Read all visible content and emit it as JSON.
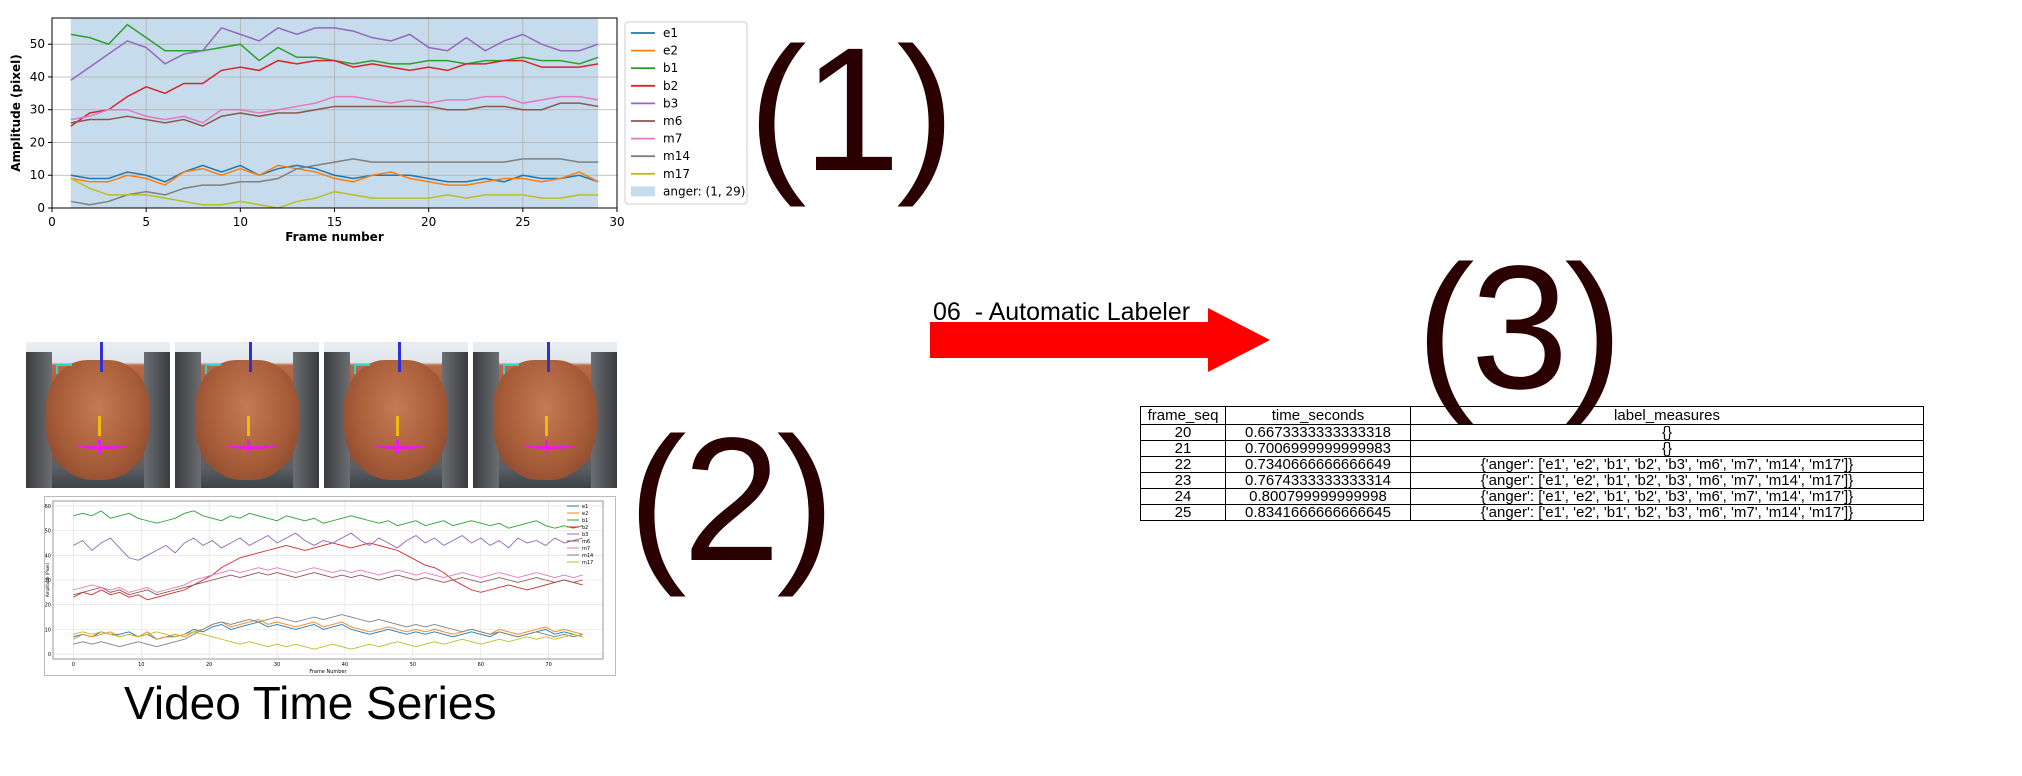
{
  "panel_labels": {
    "p1": "(1)",
    "p2": "(2)",
    "p3": "(3)"
  },
  "caption": "Video Time Series",
  "arrow_label": "06  - Automatic Labeler",
  "colors": {
    "arrow": "#ff0000",
    "panel_label": "#2b0000",
    "band": "#c6dcec"
  },
  "chart_data": [
    {
      "type": "line",
      "title": "",
      "xlabel": "Frame number",
      "ylabel": "Amplitude (pixel)",
      "xlim": [
        0,
        30
      ],
      "ylim": [
        0,
        58
      ],
      "xticks": [
        0,
        5,
        10,
        15,
        20,
        25,
        30
      ],
      "yticks": [
        0,
        10,
        20,
        30,
        40,
        50
      ],
      "grid": true,
      "legend_position": "outside-right",
      "band": {
        "label": "anger: (1, 29)",
        "x0": 1,
        "x1": 29
      },
      "x": [
        1,
        2,
        3,
        4,
        5,
        6,
        7,
        8,
        9,
        10,
        11,
        12,
        13,
        14,
        15,
        16,
        17,
        18,
        19,
        20,
        21,
        22,
        23,
        24,
        25,
        26,
        27,
        28,
        29
      ],
      "series": [
        {
          "name": "e1",
          "color": "#1f77b4",
          "values": [
            10,
            9,
            9,
            11,
            10,
            8,
            11,
            13,
            11,
            13,
            10,
            12,
            13,
            12,
            10,
            9,
            10,
            10,
            10,
            9,
            8,
            8,
            9,
            8,
            10,
            9,
            9,
            10,
            8
          ]
        },
        {
          "name": "e2",
          "color": "#ff7f0e",
          "values": [
            9,
            8,
            8,
            10,
            9,
            7,
            11,
            12,
            10,
            12,
            10,
            13,
            12,
            11,
            9,
            8,
            10,
            11,
            9,
            8,
            7,
            7,
            8,
            9,
            9,
            8,
            9,
            11,
            8
          ]
        },
        {
          "name": "b1",
          "color": "#2ca02c",
          "values": [
            53,
            52,
            50,
            56,
            52,
            48,
            48,
            48,
            49,
            50,
            45,
            49,
            46,
            46,
            45,
            44,
            45,
            44,
            44,
            45,
            45,
            44,
            45,
            45,
            46,
            45,
            45,
            44,
            46
          ]
        },
        {
          "name": "b2",
          "color": "#d62728",
          "values": [
            25,
            29,
            30,
            34,
            37,
            35,
            38,
            38,
            42,
            43,
            42,
            45,
            44,
            45,
            45,
            43,
            44,
            43,
            42,
            43,
            42,
            44,
            44,
            45,
            45,
            43,
            43,
            43,
            44
          ]
        },
        {
          "name": "b3",
          "color": "#9467bd",
          "values": [
            39,
            43,
            47,
            51,
            49,
            44,
            47,
            48,
            55,
            53,
            51,
            55,
            53,
            55,
            55,
            54,
            52,
            51,
            53,
            49,
            48,
            52,
            48,
            51,
            53,
            50,
            48,
            48,
            50
          ]
        },
        {
          "name": "m6",
          "color": "#8c564b",
          "values": [
            26,
            27,
            27,
            28,
            27,
            26,
            27,
            25,
            28,
            29,
            28,
            29,
            29,
            30,
            31,
            31,
            31,
            31,
            31,
            31,
            30,
            30,
            31,
            31,
            30,
            30,
            32,
            32,
            31
          ]
        },
        {
          "name": "m7",
          "color": "#e377c2",
          "values": [
            27,
            28,
            30,
            30,
            28,
            27,
            28,
            26,
            30,
            30,
            29,
            30,
            31,
            32,
            34,
            34,
            33,
            32,
            33,
            32,
            33,
            33,
            34,
            34,
            32,
            33,
            34,
            34,
            33
          ]
        },
        {
          "name": "m14",
          "color": "#7f7f7f",
          "values": [
            2,
            1,
            2,
            4,
            5,
            4,
            6,
            7,
            7,
            8,
            8,
            9,
            12,
            13,
            14,
            15,
            14,
            14,
            14,
            14,
            14,
            14,
            14,
            14,
            15,
            15,
            15,
            14,
            14
          ]
        },
        {
          "name": "m17",
          "color": "#bcbd22",
          "values": [
            9,
            6,
            4,
            4,
            4,
            3,
            2,
            1,
            1,
            2,
            1,
            0,
            2,
            3,
            5,
            4,
            3,
            3,
            3,
            3,
            4,
            3,
            4,
            4,
            4,
            3,
            3,
            4,
            4
          ]
        }
      ]
    },
    {
      "type": "line",
      "title": "",
      "xlabel": "Frame Number",
      "ylabel": "Amplitude (Pixel)",
      "xlim": [
        -3,
        78
      ],
      "ylim": [
        -2,
        62
      ],
      "xticks": [
        0,
        10,
        20,
        30,
        40,
        50,
        60,
        70
      ],
      "yticks": [
        0,
        10,
        20,
        30,
        40,
        50,
        60
      ],
      "grid": true,
      "legend_position": "top-right",
      "series_names": [
        "e1",
        "e2",
        "b1",
        "b2",
        "b3",
        "m6",
        "m7",
        "m14",
        "m17"
      ],
      "series": [
        {
          "name": "e1",
          "color": "#1f77b4",
          "values": [
            7,
            8,
            7,
            9,
            8,
            8,
            9,
            7,
            8,
            6,
            7,
            7,
            8,
            10,
            9,
            11,
            12,
            10,
            11,
            12,
            13,
            11,
            12,
            11,
            10,
            11,
            12,
            10,
            11,
            12,
            10,
            9,
            8,
            9,
            10,
            9,
            8,
            9,
            8,
            9,
            8,
            7,
            8,
            9,
            8,
            7,
            9,
            8,
            7,
            8,
            9,
            10,
            8,
            9,
            8,
            7
          ]
        },
        {
          "name": "e2",
          "color": "#ff7f0e",
          "values": [
            6,
            8,
            7,
            8,
            9,
            7,
            8,
            7,
            9,
            6,
            7,
            8,
            7,
            9,
            10,
            12,
            13,
            11,
            12,
            13,
            14,
            12,
            13,
            12,
            11,
            12,
            13,
            11,
            12,
            13,
            11,
            10,
            9,
            10,
            11,
            10,
            9,
            10,
            9,
            10,
            9,
            8,
            9,
            10,
            9,
            8,
            10,
            9,
            8,
            9,
            10,
            11,
            9,
            10,
            9,
            8
          ]
        },
        {
          "name": "b1",
          "color": "#2ca02c",
          "values": [
            56,
            57,
            56,
            58,
            55,
            56,
            57,
            55,
            54,
            53,
            54,
            55,
            57,
            58,
            56,
            55,
            54,
            56,
            55,
            57,
            56,
            55,
            54,
            56,
            55,
            54,
            55,
            53,
            54,
            55,
            56,
            55,
            54,
            53,
            54,
            52,
            53,
            54,
            52,
            53,
            54,
            52,
            53,
            54,
            53,
            52,
            53,
            51,
            52,
            53,
            54,
            52,
            51,
            52,
            51,
            52
          ]
        },
        {
          "name": "b2",
          "color": "#d62728",
          "values": [
            23,
            25,
            24,
            26,
            24,
            25,
            23,
            24,
            22,
            23,
            24,
            25,
            26,
            28,
            30,
            32,
            35,
            37,
            39,
            40,
            41,
            42,
            43,
            44,
            43,
            42,
            43,
            44,
            45,
            44,
            43,
            44,
            45,
            44,
            43,
            42,
            40,
            38,
            36,
            35,
            33,
            30,
            28,
            26,
            25,
            26,
            27,
            28,
            27,
            26,
            27,
            28,
            29,
            30,
            29,
            28
          ]
        },
        {
          "name": "b3",
          "color": "#9467bd",
          "values": [
            44,
            46,
            42,
            45,
            47,
            43,
            39,
            38,
            40,
            42,
            44,
            41,
            45,
            47,
            44,
            46,
            43,
            45,
            47,
            44,
            46,
            48,
            45,
            47,
            49,
            46,
            44,
            46,
            45,
            47,
            49,
            46,
            44,
            47,
            45,
            43,
            46,
            48,
            45,
            47,
            44,
            46,
            48,
            45,
            47,
            44,
            46,
            43,
            47,
            45,
            46,
            44,
            47,
            45,
            46,
            47
          ]
        },
        {
          "name": "m6",
          "color": "#8c564b",
          "values": [
            24,
            25,
            26,
            27,
            25,
            26,
            24,
            25,
            26,
            24,
            25,
            26,
            27,
            28,
            29,
            30,
            31,
            32,
            31,
            32,
            33,
            32,
            33,
            32,
            31,
            32,
            33,
            32,
            31,
            32,
            31,
            32,
            31,
            30,
            31,
            32,
            31,
            30,
            31,
            30,
            29,
            30,
            31,
            30,
            29,
            30,
            31,
            30,
            29,
            30,
            31,
            30,
            29,
            30,
            29,
            30
          ]
        },
        {
          "name": "m7",
          "color": "#e377c2",
          "values": [
            26,
            27,
            28,
            27,
            26,
            27,
            25,
            26,
            27,
            25,
            26,
            27,
            28,
            30,
            31,
            32,
            33,
            34,
            33,
            34,
            35,
            34,
            35,
            34,
            33,
            34,
            35,
            34,
            33,
            34,
            33,
            34,
            33,
            32,
            33,
            34,
            33,
            32,
            33,
            32,
            31,
            32,
            33,
            32,
            31,
            32,
            33,
            32,
            31,
            32,
            33,
            32,
            31,
            32,
            31,
            32
          ]
        },
        {
          "name": "m14",
          "color": "#7f7f7f",
          "values": [
            4,
            5,
            4,
            5,
            4,
            3,
            4,
            5,
            4,
            3,
            4,
            5,
            6,
            8,
            10,
            12,
            13,
            12,
            13,
            14,
            13,
            14,
            15,
            14,
            13,
            14,
            15,
            14,
            15,
            16,
            15,
            14,
            13,
            14,
            13,
            12,
            11,
            12,
            11,
            12,
            11,
            10,
            9,
            10,
            9,
            8,
            9,
            8,
            7,
            8,
            9,
            8,
            7,
            8,
            7,
            8
          ]
        },
        {
          "name": "m17",
          "color": "#bcbd22",
          "values": [
            8,
            9,
            8,
            9,
            8,
            7,
            8,
            7,
            8,
            9,
            8,
            7,
            8,
            9,
            8,
            7,
            6,
            5,
            4,
            5,
            4,
            3,
            4,
            3,
            4,
            3,
            2,
            3,
            4,
            3,
            2,
            3,
            4,
            3,
            4,
            5,
            4,
            3,
            4,
            5,
            4,
            5,
            6,
            5,
            4,
            5,
            6,
            5,
            6,
            7,
            6,
            7,
            6,
            7,
            8,
            7
          ]
        }
      ]
    }
  ],
  "table": {
    "headers": [
      "frame_seq",
      "time_seconds",
      "label_measures"
    ],
    "rows": [
      [
        "20",
        "0.6673333333333318",
        "{}"
      ],
      [
        "21",
        "0.7006999999999983",
        "{}"
      ],
      [
        "22",
        "0.7340666666666649",
        "{'anger': ['e1', 'e2', 'b1', 'b2', 'b3', 'm6', 'm7', 'm14', 'm17']}"
      ],
      [
        "23",
        "0.7674333333333314",
        "{'anger': ['e1', 'e2', 'b1', 'b2', 'b3', 'm6', 'm7', 'm14', 'm17']}"
      ],
      [
        "24",
        "0.800799999999998",
        "{'anger': ['e1', 'e2', 'b1', 'b2', 'b3', 'm6', 'm7', 'm14', 'm17']}"
      ],
      [
        "25",
        "0.8341666666666645",
        "{'anger': ['e1', 'e2', 'b1', 'b2', 'b3', 'm6', 'm7', 'm14', 'm17']}"
      ]
    ]
  }
}
